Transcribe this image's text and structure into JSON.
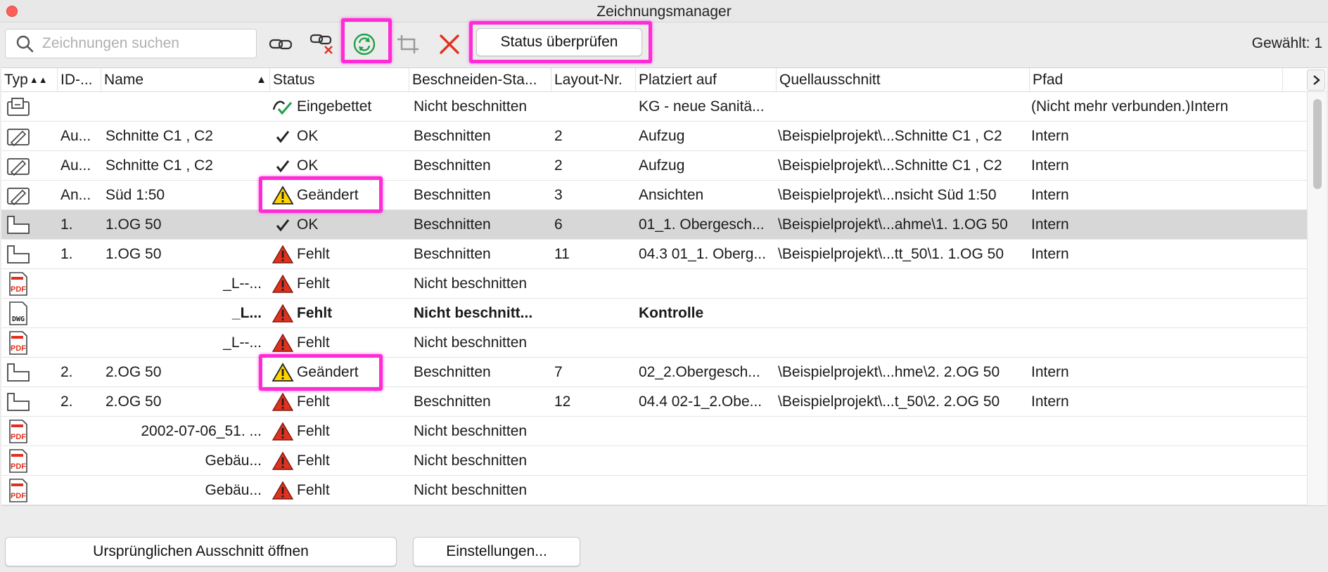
{
  "window": {
    "title": "Zeichnungsmanager"
  },
  "toolbar": {
    "search_placeholder": "Zeichnungen suchen",
    "status_check_label": "Status überprüfen",
    "selected_label": "Gewählt: 1",
    "icons": [
      "link-icon",
      "unlink-icon",
      "update-icon",
      "crop-icon",
      "delete-icon"
    ]
  },
  "columns": [
    "Typ",
    "ID-...",
    "Name",
    "Status",
    "Beschneiden-Sta...",
    "Layout-Nr.",
    "Platziert auf",
    "Quellausschnitt",
    "Pfad"
  ],
  "rows": [
    {
      "type": "placed",
      "id": "",
      "name": "",
      "status": "Eingebettet",
      "status_kind": "embedded",
      "crop": "Nicht beschnitten",
      "layout": "",
      "placed": "KG - neue Sanitä...",
      "source": "",
      "path": "(Nicht mehr verbunden.)Intern"
    },
    {
      "type": "drawing",
      "id": "Au...",
      "name": "Schnitte C1 , C2",
      "status": "OK",
      "status_kind": "ok",
      "crop": "Beschnitten",
      "layout": "2",
      "placed": "Aufzug",
      "source": "\\Beispielprojekt\\...Schnitte C1 , C2",
      "path": "Intern"
    },
    {
      "type": "drawing",
      "id": "Au...",
      "name": "Schnitte C1 , C2",
      "status": "OK",
      "status_kind": "ok",
      "crop": "Beschnitten",
      "layout": "2",
      "placed": "Aufzug",
      "source": "\\Beispielprojekt\\...Schnitte C1 , C2",
      "path": "Intern"
    },
    {
      "type": "drawing",
      "id": "An...",
      "name": "Süd 1:50",
      "status": "Geändert",
      "status_kind": "changed",
      "crop": "Beschnitten",
      "layout": "3",
      "placed": "Ansichten",
      "source": "\\Beispielprojekt\\...nsicht  Süd 1:50",
      "path": "Intern"
    },
    {
      "type": "plan",
      "id": "1.",
      "name": "1.OG 50",
      "status": "OK",
      "status_kind": "ok",
      "crop": "Beschnitten",
      "layout": "6",
      "placed": "01_1. Obergesch...",
      "source": "\\Beispielprojekt\\...ahme\\1. 1.OG 50",
      "path": "Intern"
    },
    {
      "type": "plan",
      "id": "1.",
      "name": "1.OG 50",
      "status": "Fehlt",
      "status_kind": "missing",
      "crop": "Beschnitten",
      "layout": "11",
      "placed": "04.3 01_1. Oberg...",
      "source": "\\Beispielprojekt\\...tt_50\\1. 1.OG 50",
      "path": "Intern"
    },
    {
      "type": "pdf",
      "id": "",
      "name": "_L--...",
      "status": "Fehlt",
      "status_kind": "missing",
      "crop": "Nicht beschnitten",
      "layout": "",
      "placed": "",
      "source": "",
      "path": ""
    },
    {
      "type": "dwg",
      "id": "",
      "name": "_L...",
      "status": "Fehlt",
      "status_kind": "missing",
      "crop": "Nicht beschnitt...",
      "layout": "",
      "placed": "Kontrolle",
      "source": "",
      "path": ""
    },
    {
      "type": "pdf",
      "id": "",
      "name": "_L--...",
      "status": "Fehlt",
      "status_kind": "missing",
      "crop": "Nicht beschnitten",
      "layout": "",
      "placed": "",
      "source": "",
      "path": ""
    },
    {
      "type": "plan",
      "id": "2.",
      "name": "2.OG 50",
      "status": "Geändert",
      "status_kind": "changed",
      "crop": "Beschnitten",
      "layout": "7",
      "placed": "02_2.Obergesch...",
      "source": "\\Beispielprojekt\\...hme\\2. 2.OG 50",
      "path": "Intern"
    },
    {
      "type": "plan",
      "id": "2.",
      "name": "2.OG 50",
      "status": "Fehlt",
      "status_kind": "missing",
      "crop": "Beschnitten",
      "layout": "12",
      "placed": "04.4 02-1_2.Obe...",
      "source": "\\Beispielprojekt\\...t_50\\2. 2.OG 50",
      "path": "Intern"
    },
    {
      "type": "pdf",
      "id": "",
      "name": "2002-07-06_51.        ...",
      "status": "Fehlt",
      "status_kind": "missing",
      "crop": "Nicht beschnitten",
      "layout": "",
      "placed": "",
      "source": "",
      "path": ""
    },
    {
      "type": "pdf",
      "id": "",
      "name": "Gebäu...",
      "status": "Fehlt",
      "status_kind": "missing",
      "crop": "Nicht beschnitten",
      "layout": "",
      "placed": "",
      "source": "",
      "path": ""
    },
    {
      "type": "pdf",
      "id": "",
      "name": "Gebäu...",
      "status": "Fehlt",
      "status_kind": "missing",
      "crop": "Nicht beschnitten",
      "layout": "",
      "placed": "",
      "source": "",
      "path": ""
    }
  ],
  "footer": {
    "open_source_label": "Ursprünglichen Ausschnitt öffnen",
    "settings_label": "Einstellungen..."
  },
  "colors": {
    "highlight": "#ff2bd6",
    "selected_row": "#d7d7d7",
    "missing": "#e0311f",
    "changed": "#ffd500",
    "update": "#22a04a"
  }
}
